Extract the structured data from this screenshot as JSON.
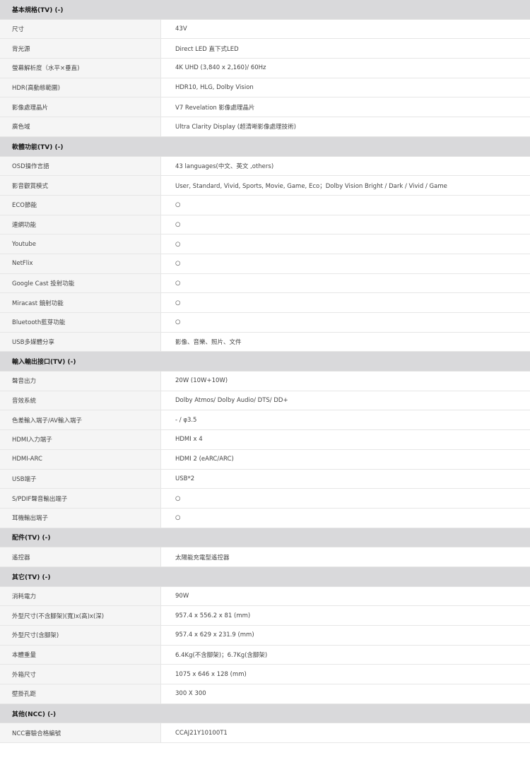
{
  "sections": [
    {
      "title": "基本規格(TV) (-)",
      "rows": [
        {
          "label": "尺寸",
          "value": "43V"
        },
        {
          "label": "背光源",
          "value": "Direct LED 直下式LED"
        },
        {
          "label": "螢幕解析度（水平×垂直)",
          "value": "4K UHD (3,840 x 2,160)/ 60Hz"
        },
        {
          "label": "HDR(高動態範圍)",
          "value": "HDR10, HLG, Dolby Vision"
        },
        {
          "label": "影像處理晶片",
          "value": "V7 Revelation 影像處理晶片"
        },
        {
          "label": "廣色域",
          "value": "Ultra Clarity Display (超清晰影像處理技術)"
        }
      ]
    },
    {
      "title": "軟體功能(TV) (-)",
      "rows": [
        {
          "label": "OSD操作言語",
          "value": "43 languages(中文、英文 ,others)"
        },
        {
          "label": "影音觀賞模式",
          "value": "User, Standard, Vivid, Sports, Movie, Game, Eco；Dolby Vision Bright / Dark / Vivid / Game"
        },
        {
          "label": "ECO節能",
          "value": "○"
        },
        {
          "label": "連網功能",
          "value": "○"
        },
        {
          "label": "Youtube",
          "value": "○"
        },
        {
          "label": "NetFlix",
          "value": "○"
        },
        {
          "label": "Google Cast 投射功能",
          "value": "○"
        },
        {
          "label": "Miracast 鏡射功能",
          "value": "○"
        },
        {
          "label": "Bluetooth藍芽功能",
          "value": "○"
        },
        {
          "label": "USB多媒體分享",
          "value": "影像、音樂、照片、文件"
        }
      ]
    },
    {
      "title": "輸入輸出接口(TV) (-)",
      "rows": [
        {
          "label": "聲音出力",
          "value": "20W (10W+10W)"
        },
        {
          "label": "音效系統",
          "value": "Dolby Atmos/ Dolby Audio/ DTS/ DD+"
        },
        {
          "label": "色差輸入端子/AV輸入端子",
          "value": "- / φ3.5"
        },
        {
          "label": "HDMI入力端子",
          "value": "HDMI x 4"
        },
        {
          "label": "HDMI-ARC",
          "value": "HDMI 2 (eARC/ARC)"
        },
        {
          "label": "USB端子",
          "value": "USB*2"
        },
        {
          "label": "S/PDIF聲音輸出端子",
          "value": "○"
        },
        {
          "label": "耳機輸出端子",
          "value": "○"
        }
      ]
    },
    {
      "title": "配件(TV) (-)",
      "rows": [
        {
          "label": "遙控器",
          "value": "太陽能充電型遙控器"
        }
      ]
    },
    {
      "title": "其它(TV) (-)",
      "rows": [
        {
          "label": "消耗電力",
          "value": "90W"
        },
        {
          "label": "外型尺寸(不含腳架)(寬)x(高)x(深)",
          "value": "957.4 x 556.2 x 81 (mm)"
        },
        {
          "label": "外型尺寸(含腳架)",
          "value": "957.4 x 629 x 231.9 (mm)"
        },
        {
          "label": "本體重量",
          "value": "6.4Kg(不含腳架)；6.7Kg(含腳架)"
        },
        {
          "label": "外箱尺寸",
          "value": "1075 x 646 x 128 (mm)"
        },
        {
          "label": "壁掛孔距",
          "value": "300 X 300"
        }
      ]
    },
    {
      "title": "其他(NCC) (-)",
      "rows": [
        {
          "label": "NCC審驗合格編號",
          "value": "CCAJ21Y10100T1"
        }
      ]
    }
  ]
}
